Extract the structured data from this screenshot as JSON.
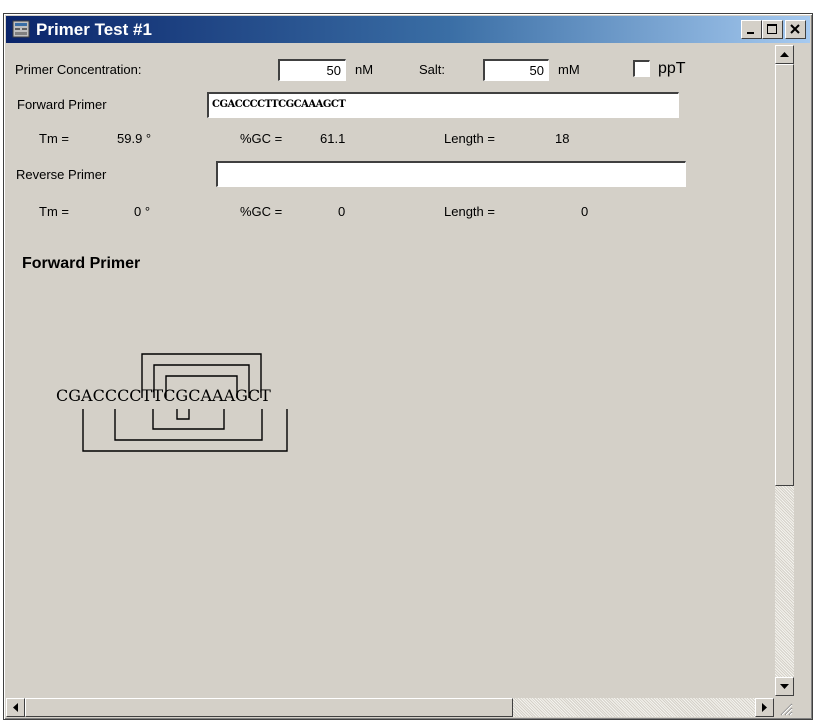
{
  "window": {
    "title": "Primer Test #1",
    "icons": {
      "app": "app-window-icon",
      "minimize": "minimize-icon",
      "maximize": "maximize-icon",
      "close": "close-icon"
    }
  },
  "settings": {
    "primer_concentration_label": "Primer Concentration:",
    "primer_concentration_value": "50",
    "primer_concentration_unit": "nM",
    "salt_label": "Salt:",
    "salt_value": "50",
    "salt_unit": "mM",
    "ppt_label": "ppT",
    "ppt_checked": false
  },
  "forward": {
    "label": "Forward Primer",
    "sequence": "CGACCCCTTCGCAAAGCT",
    "tm_label": "Tm =",
    "tm_value": "59.9 °",
    "gc_label": "%GC =",
    "gc_value": "61.1",
    "length_label": "Length =",
    "length_value": "18"
  },
  "reverse": {
    "label": "Reverse Primer",
    "sequence": "",
    "tm_label": "Tm =",
    "tm_value": "0 °",
    "gc_label": "%GC =",
    "gc_value": "0",
    "length_label": "Length =",
    "length_value": "0"
  },
  "diagram": {
    "title": "Forward Primer",
    "sequence": "CGACCCCTTCGCAAAGCT"
  },
  "scrollbars": {
    "up": "scroll-up-icon",
    "down": "scroll-down-icon",
    "left": "scroll-left-icon",
    "right": "scroll-right-icon",
    "grip": "resize-grip-icon"
  }
}
